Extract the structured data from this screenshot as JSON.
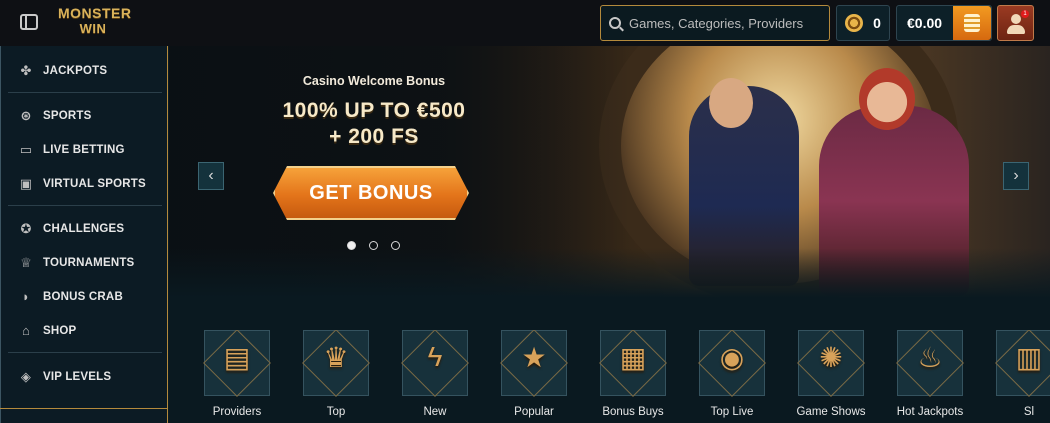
{
  "header": {
    "logo_line1": "MONSTER",
    "logo_line2": "WIN",
    "search_placeholder": "Games, Categories, Providers",
    "coins_value": "0",
    "balance": "€0.00",
    "notifications_badge": "1"
  },
  "sidebar": {
    "items": [
      {
        "label": "JACKPOTS",
        "icon": "clover-icon"
      },
      {
        "label": "SPORTS",
        "icon": "ball-icon"
      },
      {
        "label": "LIVE BETTING",
        "icon": "live-icon"
      },
      {
        "label": "VIRTUAL SPORTS",
        "icon": "monitor-icon"
      },
      {
        "label": "CHALLENGES",
        "icon": "medal-icon"
      },
      {
        "label": "TOURNAMENTS",
        "icon": "trophy-icon"
      },
      {
        "label": "BONUS CRAB",
        "icon": "crab-icon"
      },
      {
        "label": "SHOP",
        "icon": "basket-icon"
      },
      {
        "label": "VIP LEVELS",
        "icon": "diamond-icon"
      }
    ]
  },
  "hero": {
    "title": "Casino Welcome Bonus",
    "headline_line1": "100% UP TO €500",
    "headline_line2": "+ 200 FS",
    "button_label": "GET BONUS",
    "slides": 3,
    "active_slide": 1
  },
  "categories": [
    {
      "label": "Providers",
      "icon": "book-icon"
    },
    {
      "label": "Top",
      "icon": "crown-icon"
    },
    {
      "label": "New",
      "icon": "lightning-icon"
    },
    {
      "label": "Popular",
      "icon": "star-icon"
    },
    {
      "label": "Bonus Buys",
      "icon": "chest-icon"
    },
    {
      "label": "Top Live",
      "icon": "chip-icon"
    },
    {
      "label": "Game Shows",
      "icon": "wheel-icon"
    },
    {
      "label": "Hot Jackpots",
      "icon": "flame-icon"
    },
    {
      "label": "Sl",
      "icon": "slot-icon"
    }
  ]
}
